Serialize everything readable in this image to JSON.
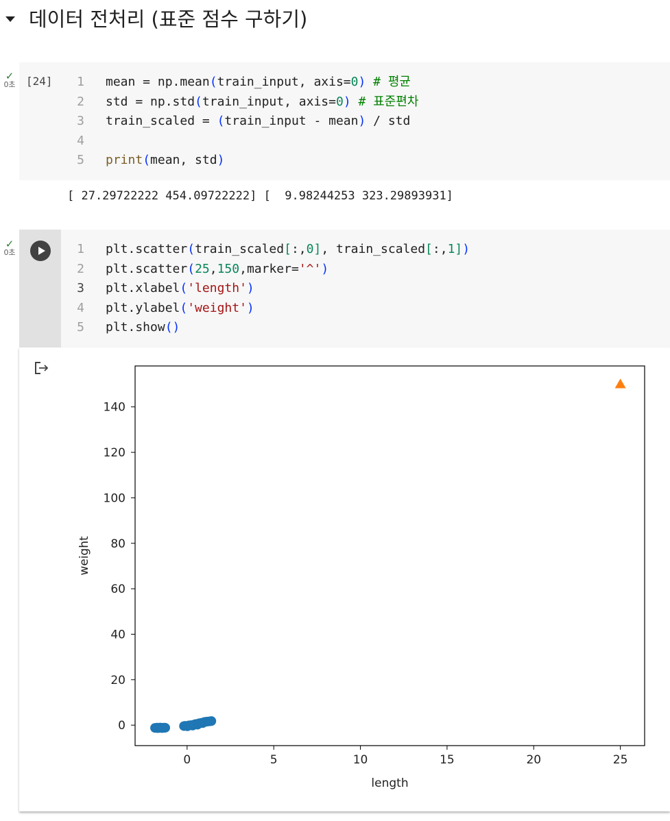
{
  "section": {
    "title": "데이터 전처리 (표준 점수 구하기)"
  },
  "cell1": {
    "exec_count": "[24]",
    "status_time": "0초",
    "lines": [
      {
        "num": "1",
        "tokens": [
          {
            "t": "mean = np.mean",
            "c": ""
          },
          {
            "t": "(",
            "c": "t-par"
          },
          {
            "t": "train_input, axis=",
            "c": ""
          },
          {
            "t": "0",
            "c": "t-num"
          },
          {
            "t": ")",
            "c": "t-par"
          },
          {
            "t": " ",
            "c": ""
          },
          {
            "t": "# 평균",
            "c": "t-com"
          }
        ]
      },
      {
        "num": "2",
        "tokens": [
          {
            "t": "std = np.std",
            "c": ""
          },
          {
            "t": "(",
            "c": "t-par"
          },
          {
            "t": "train_input, axis=",
            "c": ""
          },
          {
            "t": "0",
            "c": "t-num"
          },
          {
            "t": ")",
            "c": "t-par"
          },
          {
            "t": " ",
            "c": ""
          },
          {
            "t": "# 표준편차",
            "c": "t-com"
          }
        ]
      },
      {
        "num": "3",
        "tokens": [
          {
            "t": "train_scaled = ",
            "c": ""
          },
          {
            "t": "(",
            "c": "t-par"
          },
          {
            "t": "train_input - mean",
            "c": ""
          },
          {
            "t": ")",
            "c": "t-par"
          },
          {
            "t": " / std",
            "c": ""
          }
        ]
      },
      {
        "num": "4",
        "tokens": []
      },
      {
        "num": "5",
        "tokens": [
          {
            "t": "print",
            "c": "t-fn"
          },
          {
            "t": "(",
            "c": "t-par"
          },
          {
            "t": "mean, std",
            "c": ""
          },
          {
            "t": ")",
            "c": "t-par"
          }
        ]
      }
    ],
    "output": "[ 27.29722222 454.09722222] [  9.98244253 323.29893931]"
  },
  "cell2": {
    "status_time": "0초",
    "current_line": "3",
    "lines": [
      {
        "num": "1",
        "tokens": [
          {
            "t": "plt.scatter",
            "c": ""
          },
          {
            "t": "(",
            "c": "t-par"
          },
          {
            "t": "train_scaled",
            "c": ""
          },
          {
            "t": "[",
            "c": "t-num"
          },
          {
            "t": ":,",
            "c": ""
          },
          {
            "t": "0",
            "c": "t-num"
          },
          {
            "t": "]",
            "c": "t-num"
          },
          {
            "t": ", train_scaled",
            "c": ""
          },
          {
            "t": "[",
            "c": "t-num"
          },
          {
            "t": ":,",
            "c": ""
          },
          {
            "t": "1",
            "c": "t-num"
          },
          {
            "t": "]",
            "c": "t-num"
          },
          {
            "t": ")",
            "c": "t-par"
          }
        ]
      },
      {
        "num": "2",
        "tokens": [
          {
            "t": "plt.scatter",
            "c": ""
          },
          {
            "t": "(",
            "c": "t-par"
          },
          {
            "t": "25",
            "c": "t-num"
          },
          {
            "t": ",",
            "c": ""
          },
          {
            "t": "150",
            "c": "t-num"
          },
          {
            "t": ",marker=",
            "c": ""
          },
          {
            "t": "'^'",
            "c": "t-str"
          },
          {
            "t": ")",
            "c": "t-par"
          }
        ]
      },
      {
        "num": "3",
        "tokens": [
          {
            "t": "plt.xlabel",
            "c": ""
          },
          {
            "t": "(",
            "c": "t-par"
          },
          {
            "t": "'length'",
            "c": "t-str"
          },
          {
            "t": ")",
            "c": "t-par"
          }
        ]
      },
      {
        "num": "4",
        "tokens": [
          {
            "t": "plt.ylabel",
            "c": ""
          },
          {
            "t": "(",
            "c": "t-par"
          },
          {
            "t": "'weight'",
            "c": "t-str"
          },
          {
            "t": ")",
            "c": "t-par"
          }
        ]
      },
      {
        "num": "5",
        "tokens": [
          {
            "t": "plt.show",
            "c": ""
          },
          {
            "t": "(",
            "c": "t-par"
          },
          {
            "t": ")",
            "c": "t-par"
          }
        ]
      }
    ]
  },
  "colors": {
    "series_blue": "#1f77b4",
    "series_orange": "#ff7f0e",
    "check_green": "#2e7d32"
  },
  "icons": {
    "status": "check-icon",
    "run": "play-icon",
    "output": "output-redirect-icon",
    "collapse": "caret-down-icon"
  },
  "chart_data": {
    "type": "scatter",
    "title": "",
    "xlabel": "length",
    "ylabel": "weight",
    "xlim": [
      -3,
      26.4
    ],
    "ylim": [
      -9,
      158
    ],
    "xticks": [
      0,
      5,
      10,
      15,
      20,
      25
    ],
    "yticks": [
      0,
      20,
      40,
      60,
      80,
      100,
      120,
      140
    ],
    "grid": false,
    "legend": "none",
    "series": [
      {
        "color": "#1f77b4",
        "marker": "circle",
        "x": [
          -1.85,
          -1.78,
          -1.72,
          -1.68,
          -1.62,
          -1.58,
          -1.55,
          -1.5,
          -1.45,
          -1.4,
          -1.35,
          -1.3,
          -1.26,
          -0.18,
          -0.12,
          0.02,
          0.1,
          0.22,
          0.32,
          0.42,
          0.5,
          0.6,
          0.68,
          0.8,
          0.9,
          1.0,
          1.1,
          1.2,
          1.32,
          1.4
        ],
        "y": [
          -1.2,
          -1.25,
          -1.1,
          -1.3,
          -1.15,
          -1.22,
          -1.05,
          -1.18,
          -1.28,
          -1.12,
          -1.2,
          -1.08,
          -1.15,
          -0.4,
          -0.3,
          -0.5,
          -0.1,
          0.0,
          -0.2,
          0.3,
          0.5,
          0.2,
          0.8,
          1.0,
          0.9,
          1.4,
          1.5,
          1.6,
          1.7,
          1.8
        ]
      },
      {
        "color": "#ff7f0e",
        "marker": "triangle",
        "x": [
          25
        ],
        "y": [
          150
        ]
      }
    ]
  }
}
